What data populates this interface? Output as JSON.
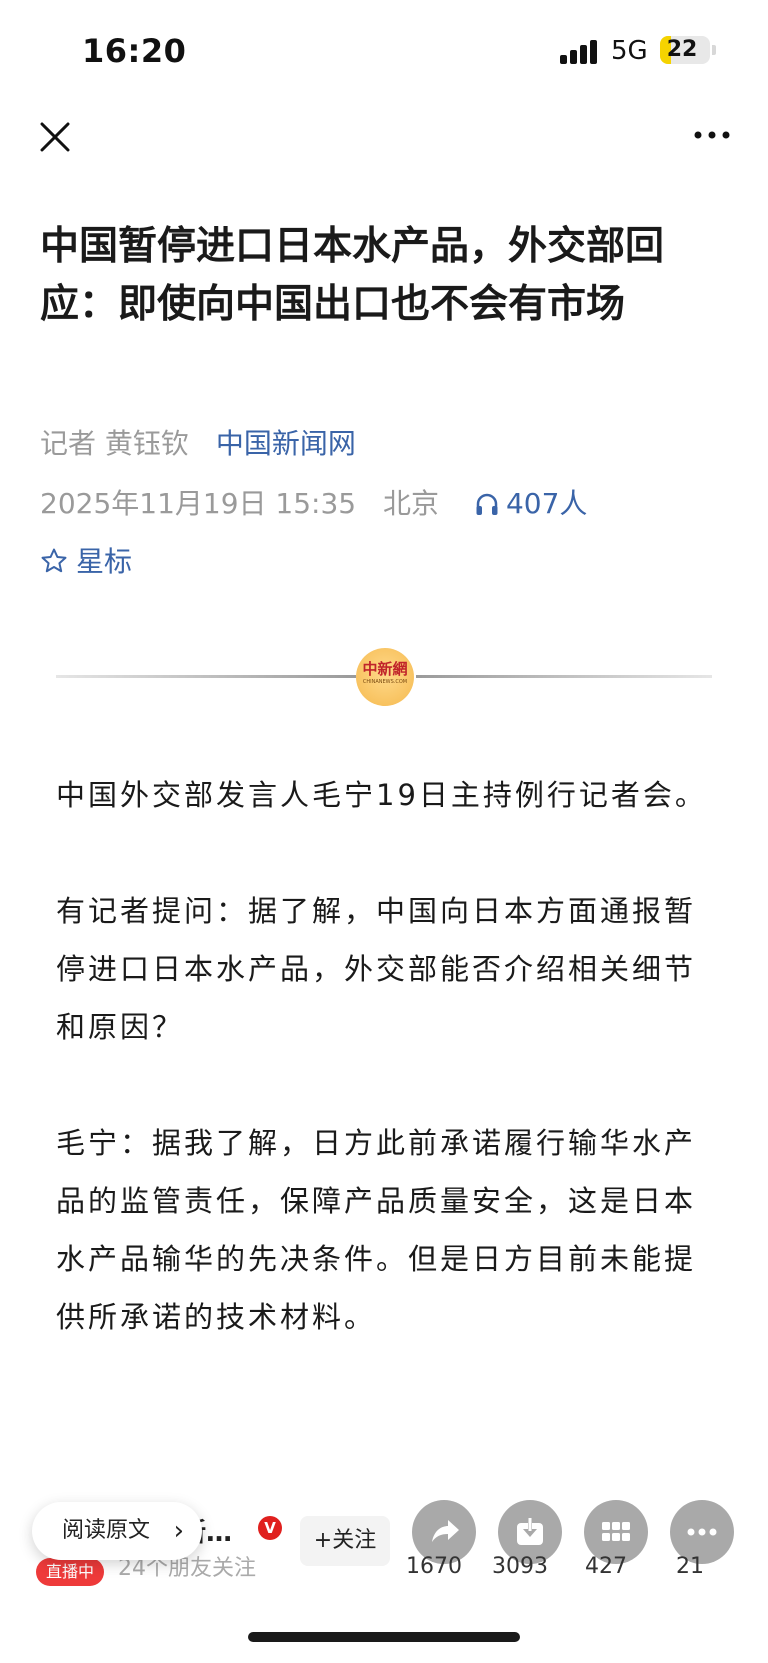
{
  "status_bar": {
    "time": "16:20",
    "network": "5G",
    "battery": "22",
    "battery_level": 0.22
  },
  "article": {
    "title": "中国暂停进口日本水产品，外交部回应：即使向中国出口也不会有市场",
    "reporter": "记者 黄钰钦",
    "source": "中国新闻网",
    "date": "2025年11月19日 15:35",
    "location": "北京",
    "listeners": "407人",
    "star_label": "星标",
    "logo_cn": "中新網",
    "logo_en": "CHINANEWS.COM",
    "paragraphs": [
      "中国外交部发言人毛宁19日主持例行记者会。",
      "有记者提问：据了解，中国向日本方面通报暂停进口日本水产品，外交部能否介绍相关细节和原因？",
      "毛宁：据我了解，日方此前承诺履行输华水产品的监管责任，保障产品质量安全，这是日本水产品输华的先决条件。但是日方目前未能提供所承诺的技术材料。"
    ]
  },
  "bottom_bar": {
    "author_name": "新…",
    "vip": "V",
    "followers": "24个朋友关注",
    "live": "直播中",
    "read_original": "阅读原文",
    "follow": "+关注",
    "share_count": "1670",
    "save_count": "3093",
    "apps_count": "427",
    "more_count": "21"
  }
}
